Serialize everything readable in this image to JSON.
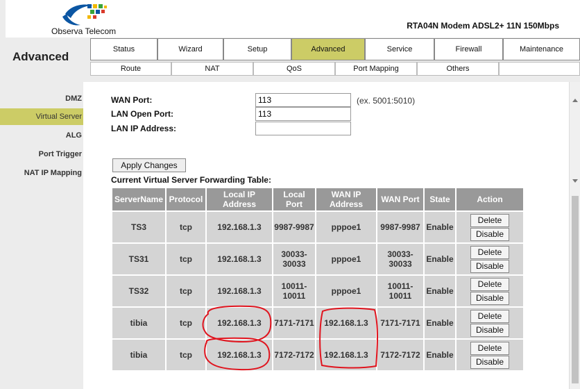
{
  "brand": {
    "name": "Observa Telecom",
    "logo_colors": [
      "#0b56a3",
      "#f2b800",
      "#3aa43a",
      "#d93a2b"
    ]
  },
  "header": {
    "model": "RTA04N Modem ADSL2+ 11N 150Mbps"
  },
  "section_title": "Advanced",
  "tabs": [
    {
      "label": "Status"
    },
    {
      "label": "Wizard"
    },
    {
      "label": "Setup"
    },
    {
      "label": "Advanced",
      "active": true
    },
    {
      "label": "Service"
    },
    {
      "label": "Firewall"
    },
    {
      "label": "Maintenance"
    }
  ],
  "subtabs": [
    {
      "label": "Route"
    },
    {
      "label": "NAT"
    },
    {
      "label": "QoS"
    },
    {
      "label": "Port Mapping"
    },
    {
      "label": "Others"
    },
    {
      "label": ""
    }
  ],
  "sidebar": {
    "items": [
      {
        "label": "DMZ"
      },
      {
        "label": "Virtual Server",
        "active": true
      },
      {
        "label": "ALG"
      },
      {
        "label": "Port Trigger"
      },
      {
        "label": "NAT IP Mapping"
      }
    ]
  },
  "form": {
    "wan_port": {
      "label": "WAN Port:",
      "value": "113",
      "hint": "(ex. 5001:5010)"
    },
    "lan_open_port": {
      "label": "LAN Open Port:",
      "value": "113"
    },
    "lan_ip": {
      "label": "LAN IP Address:",
      "value": ""
    },
    "apply_label": "Apply Changes"
  },
  "table": {
    "title": "Current Virtual Server Forwarding Table:",
    "headers": [
      "ServerName",
      "Protocol",
      "Local IP Address",
      "Local Port",
      "WAN IP Address",
      "WAN Port",
      "State",
      "Action"
    ],
    "delete_label": "Delete",
    "disable_label": "Disable",
    "rows": [
      {
        "name": "TS3",
        "protocol": "tcp",
        "local_ip": "192.168.1.3",
        "local_port": "9987-9987",
        "wan_ip": "pppoe1",
        "wan_port": "9987-9987",
        "state": "Enable"
      },
      {
        "name": "TS31",
        "protocol": "tcp",
        "local_ip": "192.168.1.3",
        "local_port": "30033-30033",
        "wan_ip": "pppoe1",
        "wan_port": "30033-30033",
        "state": "Enable"
      },
      {
        "name": "TS32",
        "protocol": "tcp",
        "local_ip": "192.168.1.3",
        "local_port": "10011-10011",
        "wan_ip": "pppoe1",
        "wan_port": "10011-10011",
        "state": "Enable"
      },
      {
        "name": "tibia",
        "protocol": "tcp",
        "local_ip": "192.168.1.3",
        "local_port": "7171-7171",
        "wan_ip": "192.168.1.3",
        "wan_port": "7171-7171",
        "state": "Enable"
      },
      {
        "name": "tibia",
        "protocol": "tcp",
        "local_ip": "192.168.1.3",
        "local_port": "7172-7172",
        "wan_ip": "192.168.1.3",
        "wan_port": "7172-7172",
        "state": "Enable"
      }
    ]
  },
  "annotation_color": "#e0141e"
}
